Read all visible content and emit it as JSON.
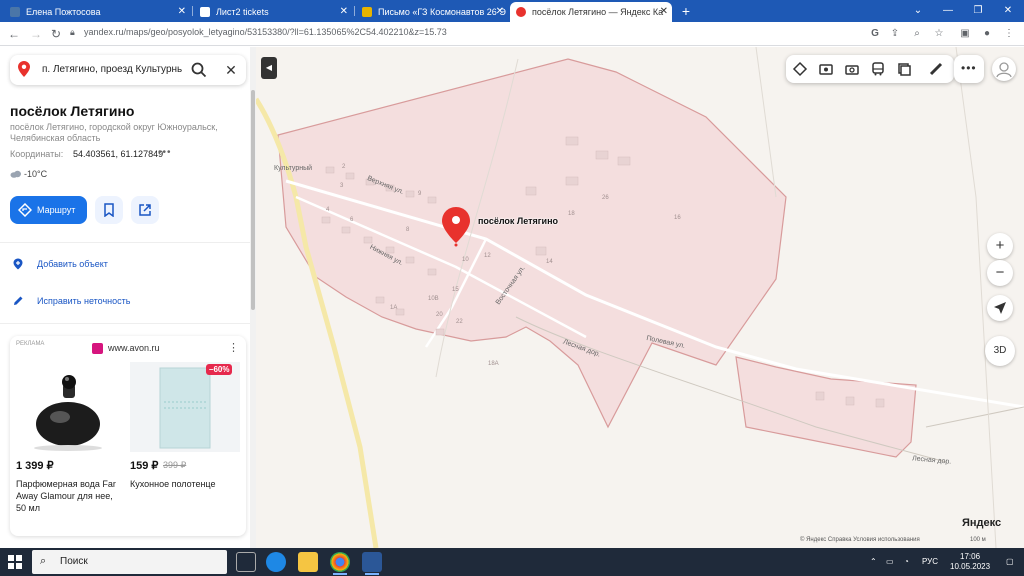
{
  "browser": {
    "tabs": [
      {
        "title": "Елена Пожтосова",
        "icon_color": "#4a76a8"
      },
      {
        "title": "Лист2 tickets",
        "icon_color": "#ffffff"
      },
      {
        "title": "Письмо «ГЗ Космонавтов 26 Э",
        "icon_color": "#e8b400"
      },
      {
        "title": "посёлок Летягино — Яндекс Ка",
        "icon_color": "#e8322d"
      }
    ],
    "new_tab": "+",
    "url": "yandex.ru/maps/geo/posyolok_letyagino/53153380/?ll=61.135065%2C54.402210&z=15.73",
    "window_controls": [
      "⌄",
      "—",
      "❐",
      "✕"
    ]
  },
  "panel": {
    "search_value": "п. Летягино, проезд Культурны",
    "place_title": "посёлок Летягино",
    "address": "посёлок Летягино, городской округ Южноуральск, Челябинская область",
    "coords_label": "Координаты:",
    "coords_value": "54.403561, 61.127849",
    "coords_more": "•••",
    "weather": "-10°C",
    "route_label": "Маршрут",
    "add_object": "Добавить объект",
    "fix_inaccuracy": "Исправить неточность",
    "ad": {
      "label": "РЕКЛАМА",
      "domain": "www.avon.ru",
      "menu": "⋮",
      "discount": "–60%",
      "product1": {
        "price": "1 399 ₽",
        "name": "Парфюмерная вода Far Away Glamour для нее, 50 мл"
      },
      "product2": {
        "price": "159 ₽",
        "old_price": "399 ₽",
        "name": "Кухонное полотенце"
      }
    }
  },
  "map": {
    "pin_label": "посёлок Летягино",
    "streets": {
      "verkhnyaya": "Верхняя ул.",
      "nizhnyaya": "Нижняя ул.",
      "vostochnaya": "Восточная ул.",
      "polevaya": "Полевая ул.",
      "lesnaya1": "Лесная дор.",
      "lesnaya2": "Лесная дор.",
      "kulturny": "Культурный"
    },
    "houses": [
      "2",
      "3",
      "4",
      "6",
      "8",
      "9",
      "10",
      "12",
      "14",
      "15",
      "16",
      "18",
      "20",
      "22",
      "26",
      "1А",
      "18А",
      "10В"
    ],
    "zoom_in": "+",
    "zoom_out": "−",
    "btn_3d": "3D",
    "logo": "Яндекс",
    "footer": "© Яндекс   Справка   Условия использования",
    "scale": "100 м"
  },
  "taskbar": {
    "search_text": "Поиск",
    "lang": "РУС",
    "time": "17:06",
    "date": "10.05.2023"
  }
}
